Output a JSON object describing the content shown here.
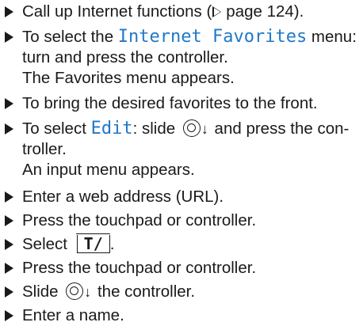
{
  "steps": {
    "s1": {
      "text": "Call up Internet functions (",
      "page_ref": "page 124).",
      "page_ref_prefix": ""
    },
    "s2": {
      "prefix": "To select the ",
      "menu": "Internet Favorites",
      "suffix": " menu:",
      "cont1": "turn and press the controller.",
      "cont2": "The Favorites menu appears."
    },
    "s3": {
      "text": "To bring the desired favorites to the front."
    },
    "s4": {
      "prefix": "To select ",
      "menu": "Edit",
      "mid": ": slide ",
      "suffix": " and press the con-",
      "cont1": "troller.",
      "cont2": "An input menu appears."
    },
    "s5": {
      "text": "Enter a web address (URL)."
    },
    "s6": {
      "text": "Press the touchpad or controller."
    },
    "s7": {
      "prefix": "Select ",
      "key": "T/",
      "suffix": "."
    },
    "s8": {
      "text": "Press the touchpad or controller."
    },
    "s9": {
      "prefix": "Slide ",
      "suffix": " the controller."
    },
    "s10": {
      "text": "Enter a name."
    }
  },
  "colors": {
    "accent": "#1f78c8",
    "text": "#1a1a1a"
  },
  "icons": {
    "bullet": "triangle-bullet-icon",
    "controller": "controller-icon",
    "arrow": "arrow-down-icon",
    "page_ref": "page-reference-triangle-icon"
  }
}
